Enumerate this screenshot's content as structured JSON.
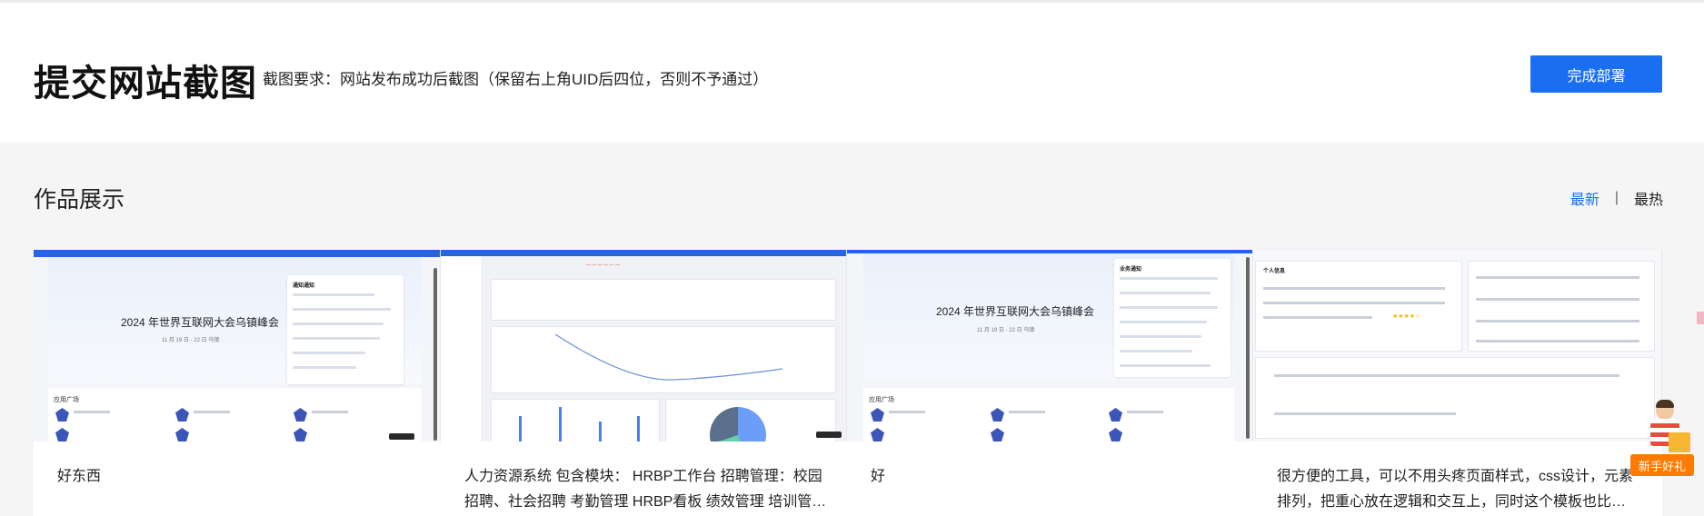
{
  "header": {
    "title": "提交网站截图",
    "requirement": "截图要求：网站发布成功后截图（保留右上角UID后四位，否则不予通过）",
    "deploy_button": "完成部署"
  },
  "showcase": {
    "title": "作品展示",
    "sort_latest": "最新",
    "sort_separator": "|",
    "sort_hottest": "最热"
  },
  "cards": [
    {
      "description": "好东西",
      "thumb_hero_title": "2024 年世界互联网大会乌镇峰会",
      "thumb_section": "应用广场",
      "thumb_notice": "通知通知"
    },
    {
      "description": "人力资源系统 包含模块： HRBP工作台 招聘管理：校园招聘、社会招聘 考勤管理 HRBP看板 绩效管理 培训管…"
    },
    {
      "description": "好",
      "thumb_hero_title": "2024 年世界互联网大会乌镇峰会",
      "thumb_section": "应用广场",
      "thumb_notice": "业务通知"
    },
    {
      "description": "很方便的工具，可以不用头疼页面样式，css设计，元素排列，把重心放在逻辑和交互上，同时这个模板也比…",
      "thumb_section": "个人信息"
    }
  ],
  "promo": {
    "label": "新手好礼"
  },
  "colors": {
    "accent": "#1a6ff0",
    "promo": "#ff7a00"
  }
}
